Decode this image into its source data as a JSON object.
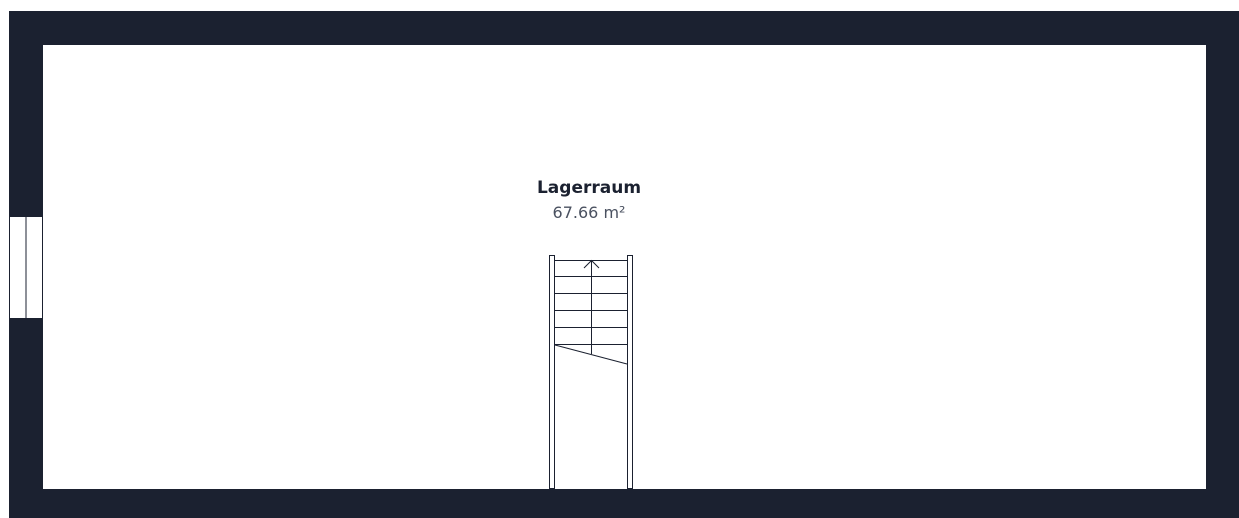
{
  "room": {
    "name": "Lagerraum",
    "area": "67.66 m²"
  },
  "colors": {
    "wall": "#1b2130",
    "floor": "#ffffff",
    "line": "#1b2130"
  },
  "icons": {
    "stair_direction": "arrow-up-icon"
  }
}
